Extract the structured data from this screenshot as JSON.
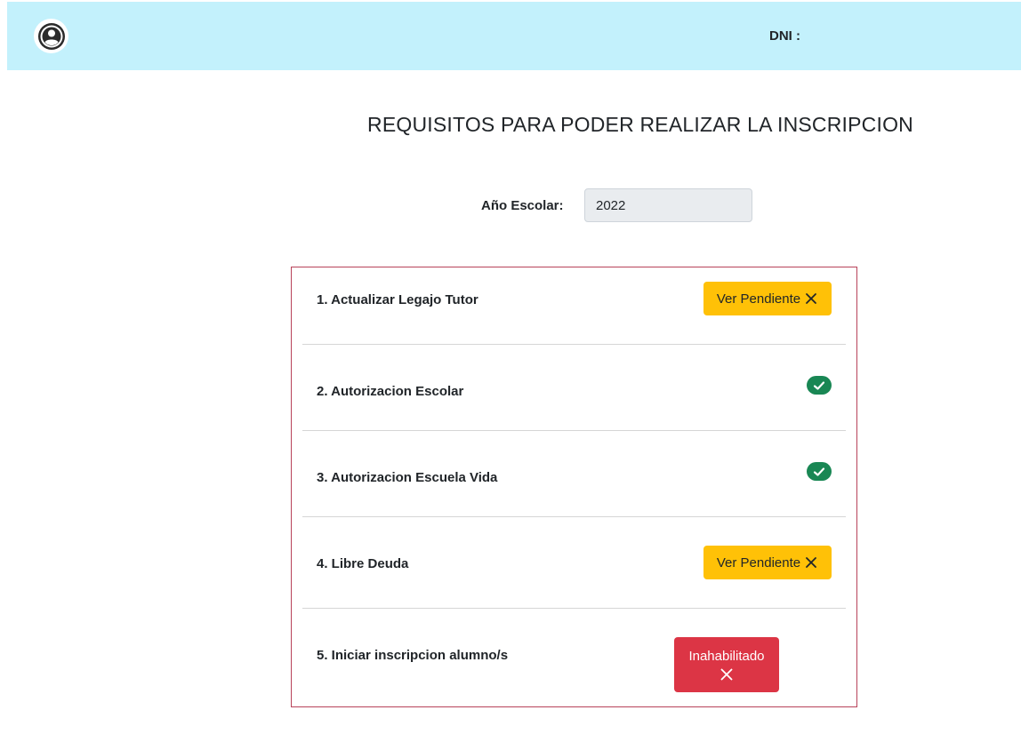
{
  "header": {
    "avatar_icon": "user-circle-icon",
    "dni_label": "DNI :",
    "background": "#c3f1fc"
  },
  "page": {
    "title": "REQUISITOS PARA PODER REALIZAR LA INSCRIPCION",
    "year_label": "Año Escolar:",
    "year_value": "2022"
  },
  "requirements": [
    {
      "label": "1. Actualizar Legajo Tutor",
      "status": "pending",
      "button_label": "Ver Pendiente",
      "icon": "x-icon"
    },
    {
      "label": "2. Autorizacion Escolar",
      "status": "done",
      "icon": "check-circle-icon"
    },
    {
      "label": "3. Autorizacion Escuela Vida",
      "status": "done",
      "icon": "check-circle-icon"
    },
    {
      "label": "4. Libre Deuda",
      "status": "pending",
      "button_label": "Ver Pendiente",
      "icon": "x-icon"
    },
    {
      "label": "5. Iniciar inscripcion alumno/s",
      "status": "disabled",
      "button_label": "Inahabilitado",
      "icon": "x-icon"
    }
  ],
  "colors": {
    "warning": "#ffc107",
    "success": "#198754",
    "danger": "#dc3545",
    "box_border": "#b8435a"
  }
}
